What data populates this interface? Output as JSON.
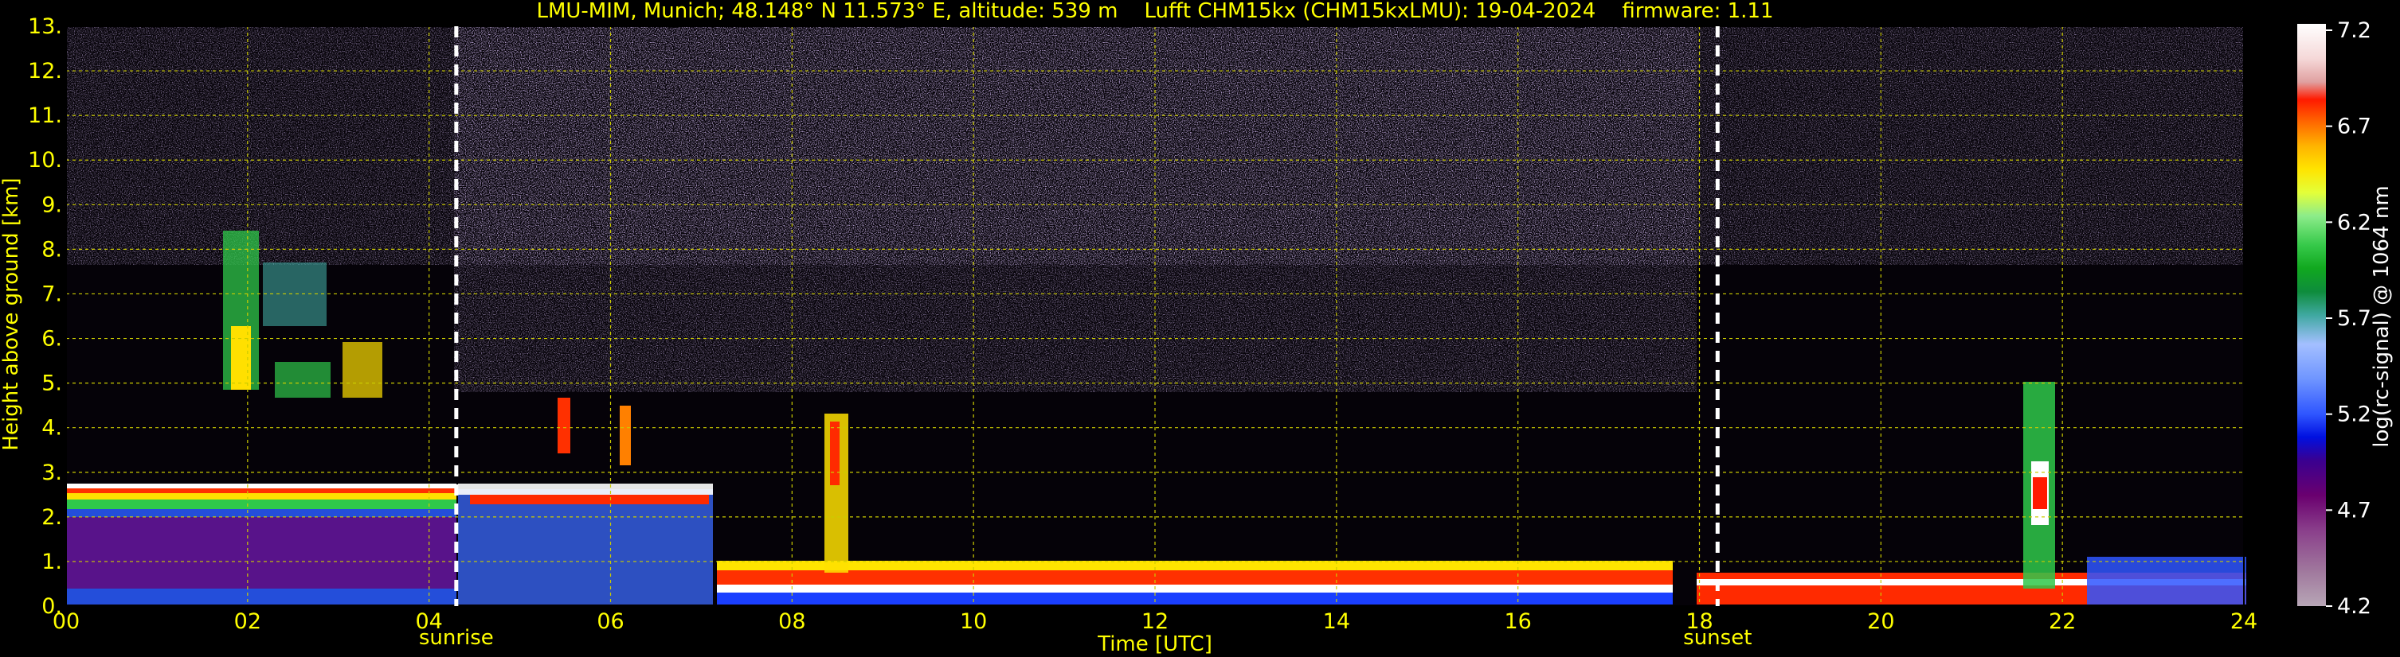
{
  "chart_data": {
    "type": "heatmap",
    "title": "LMU-MIM, Munich; 48.148° N 11.573° E, altitude: 539 m    Lufft CHM15kx (CHM15kxLMU): 19-04-2024    firmware: 1.11",
    "xlabel": "Time [UTC]",
    "ylabel": "Height above ground [km]",
    "xlim": [
      0,
      24
    ],
    "ylim": [
      0,
      13
    ],
    "x_ticks": [
      "00",
      "02",
      "04",
      "06",
      "08",
      "10",
      "12",
      "14",
      "16",
      "18",
      "20",
      "22",
      "24"
    ],
    "y_ticks": [
      "0.",
      "1.",
      "2.",
      "3.",
      "4.",
      "5.",
      "6.",
      "7.",
      "8.",
      "9.",
      "10.",
      "11.",
      "12.",
      "13."
    ],
    "grid": true,
    "markers": [
      {
        "label": "sunrise",
        "x": 4.3
      },
      {
        "label": "sunset",
        "x": 18.2
      }
    ],
    "colorbar": {
      "label": "log(rc-signal) @ 1064 nm",
      "range": [
        4.2,
        7.2
      ],
      "ticks": [
        "7.2",
        "6.7",
        "6.2",
        "5.7",
        "5.2",
        "4.7",
        "4.2"
      ]
    },
    "colors": {
      "text": "#ffff00",
      "background": "#000000",
      "grid": "#cccc00",
      "marker": "#ffffff",
      "colorbar_text": "#ffffff"
    },
    "features": [
      {
        "type": "boundary_layer",
        "x": [
          0,
          4.3
        ],
        "top_km": 2.5
      },
      {
        "type": "cloud",
        "x": [
          1.7,
          3.5
        ],
        "height_km": [
          4.5,
          8.5
        ]
      },
      {
        "type": "cloud",
        "x": [
          8.2,
          8.9
        ],
        "height_km": [
          1.0,
          4.5
        ]
      },
      {
        "type": "cloud",
        "x": [
          21.7,
          22.1
        ],
        "height_km": [
          0.5,
          5.0
        ]
      }
    ]
  }
}
